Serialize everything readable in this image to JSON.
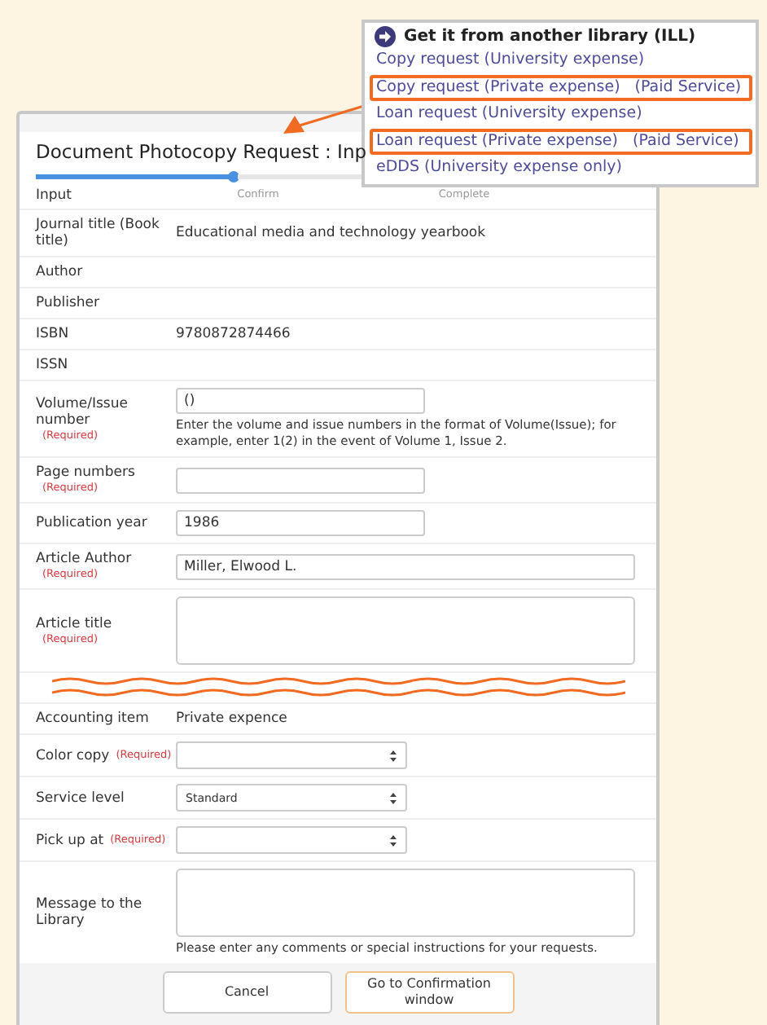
{
  "menu": {
    "title": "Get it from another library (ILL)",
    "items": [
      {
        "label": "Copy request (University expense)",
        "highlighted": false
      },
      {
        "label": "Copy request (Private expense)",
        "note": "(Paid Service)",
        "highlighted": true
      },
      {
        "label": "Loan request (University expense)",
        "highlighted": false
      },
      {
        "label": "Loan request (Private expense)",
        "note": "(Paid Service)",
        "highlighted": true
      },
      {
        "label": "eDDS (University expense only)",
        "highlighted": false
      }
    ]
  },
  "dialog": {
    "title": "Document Photocopy Request : Inp",
    "steps": [
      {
        "label": "Input",
        "selected": true
      },
      {
        "label": "Confirm",
        "selected": false
      },
      {
        "label": "Complete",
        "selected": false
      }
    ],
    "rows": [
      {
        "kind": "text",
        "label": "Journal title (Book title)",
        "value": "Educational media and technology yearbook"
      },
      {
        "kind": "text",
        "label": "Author"
      },
      {
        "kind": "text",
        "label": "Publisher"
      },
      {
        "kind": "text",
        "label": "ISBN",
        "value": "9780872874466"
      },
      {
        "kind": "text",
        "label": "ISSN"
      },
      {
        "kind": "input",
        "label": "Volume/Issue number",
        "required": "(Required)",
        "value": "()",
        "hint": "Enter the volume and issue numbers in the format of Volume(Issue); for example, enter 1(2) in the event of Volume 1, Issue 2."
      },
      {
        "kind": "input",
        "label": "Page numbers",
        "required": "(Required)"
      },
      {
        "kind": "input",
        "label": "Publication year",
        "value": "1986"
      },
      {
        "kind": "wide",
        "label": "Article Author",
        "required": "(Required)",
        "value": "Miller, Elwood L."
      },
      {
        "kind": "textarea",
        "label": "Article title",
        "required": "(Required)"
      },
      {
        "kind": "break"
      },
      {
        "kind": "text",
        "label": "Accounting item",
        "value": "Private expence"
      },
      {
        "kind": "select",
        "label": "Color copy",
        "required": "(Required)"
      },
      {
        "kind": "select",
        "label": "Service level",
        "value": "Standard"
      },
      {
        "kind": "select",
        "label": "Pick up at",
        "required": "(Required)"
      },
      {
        "kind": "textarea",
        "label": "Message to the Library",
        "hint": "Please enter any comments or special instructions for your requests."
      }
    ],
    "buttons": [
      {
        "label": "Cancel",
        "primary": false
      },
      {
        "label": "Go to Confirmation window",
        "primary": true
      }
    ]
  }
}
